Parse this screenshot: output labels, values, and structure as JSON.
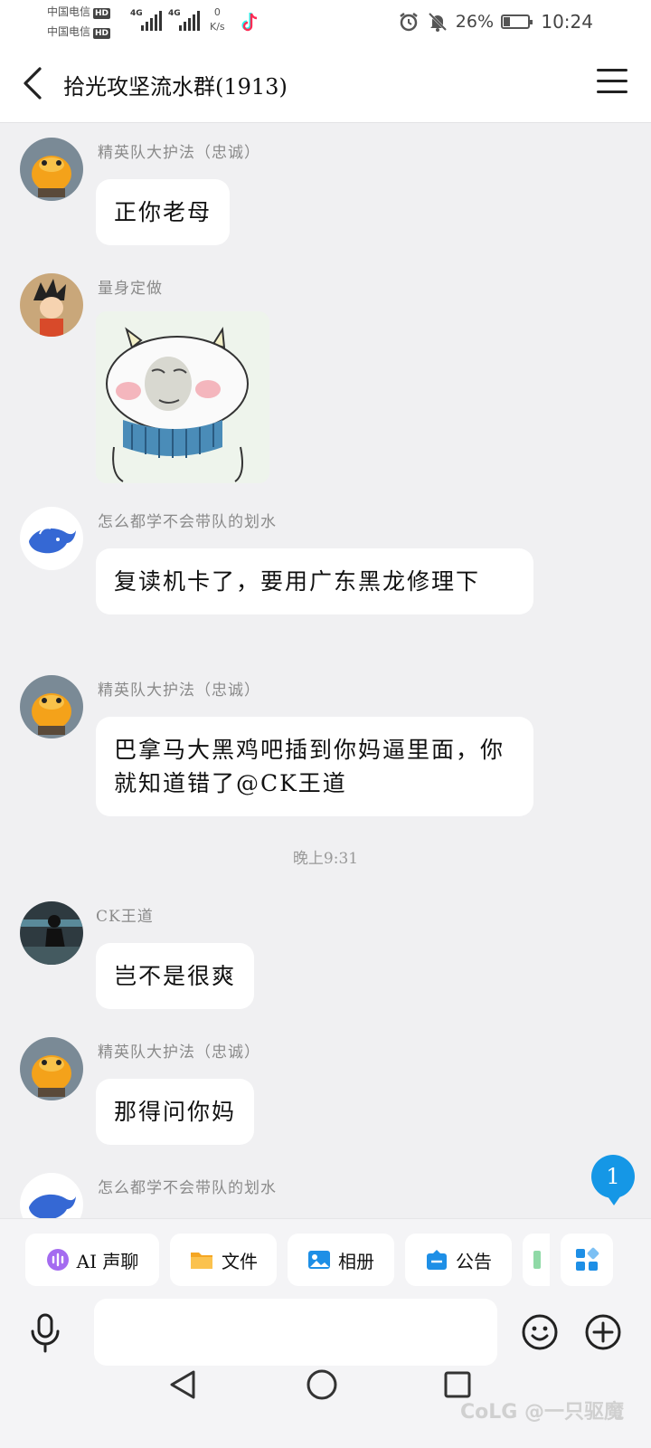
{
  "status_bar": {
    "carrier_1": "中国电信",
    "carrier_2": "中国电信",
    "hd_badge": "HD",
    "network": "4G",
    "speed_value": "0",
    "speed_unit": "K/s",
    "battery_percent": "26%",
    "battery_level": 0.26,
    "time": "10:24"
  },
  "header": {
    "title": "拾光攻坚流水群(1913)"
  },
  "messages": [
    {
      "sender": "精英队大护法（忠诚）",
      "text": "正你老母"
    },
    {
      "sender": "量身定做",
      "text": ""
    },
    {
      "sender": "怎么都学不会带队的划水",
      "text": "复读机卡了，要用广东黑龙修理下"
    },
    {
      "sender": "精英队大护法（忠诚）",
      "text": "巴拿马大黑鸡吧插到你妈逼里面，你就知道错了@CK王道"
    },
    {
      "sender": "CK王道",
      "text": "岂不是很爽"
    },
    {
      "sender": "精英队大护法（忠诚）",
      "text": "那得问你妈"
    },
    {
      "sender": "怎么都学不会带队的划水",
      "text": ""
    }
  ],
  "timestamp": "晚上9:31",
  "new_message_badge": "1",
  "toolbar": {
    "items": [
      {
        "label": "AI 声聊",
        "color": "#9b5cf6"
      },
      {
        "label": "文件",
        "color": "#f5a623"
      },
      {
        "label": "相册",
        "color": "#1e90ff"
      },
      {
        "label": "公告",
        "color": "#1e90ff"
      }
    ]
  },
  "input": {
    "placeholder": ""
  },
  "watermark": "CoLG @一只驱魔"
}
